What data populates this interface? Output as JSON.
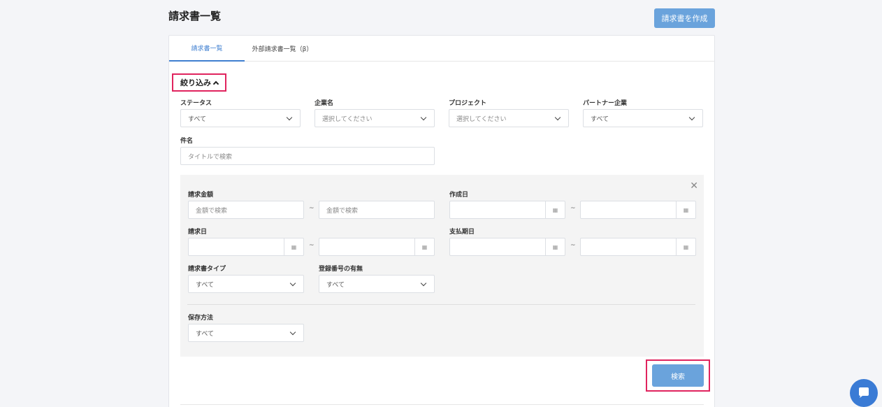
{
  "header": {
    "title": "請求書一覧",
    "create_label": "請求書を作成"
  },
  "tabs": [
    {
      "label": "請求書一覧",
      "active": true
    },
    {
      "label": "外部請求書一覧（β）",
      "active": false
    }
  ],
  "filter": {
    "toggle_label": "絞り込み",
    "status": {
      "label": "ステータス",
      "value": "すべて"
    },
    "company": {
      "label": "企業名",
      "placeholder": "選択してください"
    },
    "project": {
      "label": "プロジェクト",
      "placeholder": "選択してください"
    },
    "partner": {
      "label": "パートナー企業",
      "value": "すべて"
    },
    "subject": {
      "label": "件名",
      "placeholder": "タイトルで検索"
    }
  },
  "advanced": {
    "amount": {
      "label": "請求金額",
      "from_placeholder": "金額で検索",
      "to_placeholder": "金額で検索"
    },
    "created": {
      "label": "作成日"
    },
    "invoice_date": {
      "label": "請求日"
    },
    "payment_due": {
      "label": "支払期日"
    },
    "invoice_type": {
      "label": "請求書タイプ",
      "value": "すべて"
    },
    "registration": {
      "label": "登録番号の有無",
      "value": "すべて"
    },
    "storage": {
      "label": "保存方法",
      "value": "すべて"
    },
    "tilde": "~"
  },
  "search_label": "検索",
  "colors": {
    "accent": "#3f7fd0",
    "button": "#6aa3dc",
    "highlight": "#e0245e"
  }
}
